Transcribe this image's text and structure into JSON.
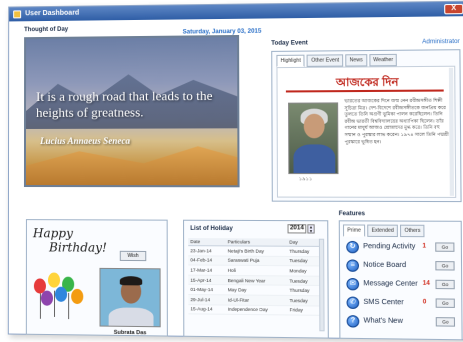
{
  "window": {
    "title": "User Dashboard",
    "close_label": "X"
  },
  "thought": {
    "heading": "Thought of Day",
    "quote": "It is a rough road that leads to the heights of greatness.",
    "author": "Lucius Annaeus Seneca"
  },
  "date": "Saturday, January 03, 2015",
  "admin_label": "Administrator",
  "event": {
    "heading": "Today Event",
    "tabs": [
      "Highlight",
      "Other Event",
      "News",
      "Weather"
    ],
    "title": "আজকের দিন",
    "photo_caption": "১৯১১",
    "text": "ভারতের আজকের দিনে জন্ম নেন রবীন্দ্রসঙ্গীত শিল্পী সুচিত্রা মিত্র। দেশ-বিদেশে রবীন্দ্রসঙ্গীতকে জনপ্রিয় করে তুলতে তিনি অগ্রণী ভূমিকা পালন করেছিলেন। তিনি রবীন্দ্র ভারতী বিশ্ববিদ্যালয়ের অধ্যাপিকা ছিলেন। তাঁর গানের মাধুর্য আজও শ্রোতাদের মুগ্ধ করে। তিনি বহু সম্মান ও পুরস্কার লাভ করেন। ১৯৭৪ সালে তিনি পদ্মশ্রী পুরস্কারে ভূষিত হন।"
  },
  "birthday": {
    "line1": "Happy",
    "line2": "Birthday!",
    "wish_label": "Wish",
    "name": "Subrata Das"
  },
  "holiday": {
    "heading": "List of Holiday",
    "year": "2014",
    "columns": [
      "Date",
      "Particulars",
      "Day"
    ],
    "rows": [
      [
        "23-Jan-14",
        "Netaji's Birth Day",
        "Thursday"
      ],
      [
        "04-Feb-14",
        "Saraswati Puja",
        "Tuesday"
      ],
      [
        "17-Mar-14",
        "Holi",
        "Monday"
      ],
      [
        "15-Apr-14",
        "Bengali New Year",
        "Tuesday"
      ],
      [
        "01-May-14",
        "May Day",
        "Thursday"
      ],
      [
        "29-Jul-14",
        "Id-Ul-Fitar",
        "Tuesday"
      ],
      [
        "15-Aug-14",
        "Independence Day",
        "Friday"
      ]
    ]
  },
  "features": {
    "heading": "Features",
    "tabs": [
      "Prime",
      "Extended",
      "Others"
    ],
    "items": [
      {
        "label": "Pending Activity",
        "count": "1",
        "go": "Go",
        "icon": "activity-icon"
      },
      {
        "label": "Notice Board",
        "count": "",
        "go": "Go",
        "icon": "notice-icon"
      },
      {
        "label": "Message Center",
        "count": "14",
        "go": "Go",
        "icon": "message-icon"
      },
      {
        "label": "SMS Center",
        "count": "0",
        "go": "Go",
        "icon": "sms-icon"
      },
      {
        "label": "What's New",
        "count": "",
        "go": "Go",
        "icon": "help-icon"
      }
    ]
  }
}
